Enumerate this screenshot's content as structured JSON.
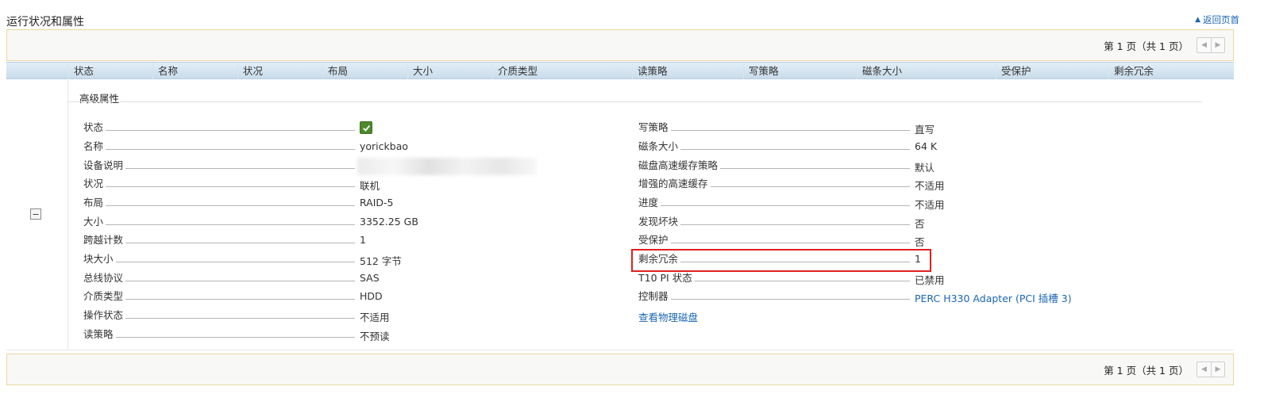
{
  "page": {
    "title": "运行状况和属性",
    "back_to_top": "返回页首"
  },
  "pager": {
    "text": "第 1 页（共 1 页）"
  },
  "table": {
    "columns": [
      "状态",
      "名称",
      "状况",
      "布局",
      "大小",
      "介质类型",
      "读策略",
      "写策略",
      "磁条大小",
      "受保护",
      "剩余冗余"
    ]
  },
  "section": {
    "title": "高级属性"
  },
  "left_props": [
    {
      "label": "状态",
      "value": ""
    },
    {
      "label": "名称",
      "value": "yorickbao"
    },
    {
      "label": "设备说明",
      "value": ""
    },
    {
      "label": "状况",
      "value": "联机"
    },
    {
      "label": "布局",
      "value": "RAID-5"
    },
    {
      "label": "大小",
      "value": "3352.25 GB"
    },
    {
      "label": "跨越计数",
      "value": "1"
    },
    {
      "label": "块大小",
      "value": "512 字节"
    },
    {
      "label": "总线协议",
      "value": "SAS"
    },
    {
      "label": "介质类型",
      "value": "HDD"
    },
    {
      "label": "操作状态",
      "value": "不适用"
    },
    {
      "label": "读策略",
      "value": "不预读"
    }
  ],
  "right_props": [
    {
      "label": "写策略",
      "value": "直写"
    },
    {
      "label": "磁条大小",
      "value": "64 K"
    },
    {
      "label": "磁盘高速缓存策略",
      "value": "默认"
    },
    {
      "label": "增强的高速缓存",
      "value": "不适用"
    },
    {
      "label": "进度",
      "value": "不适用"
    },
    {
      "label": "发现坏块",
      "value": "否"
    },
    {
      "label": "受保护",
      "value": "否"
    },
    {
      "label": "剩余冗余",
      "value": "1"
    },
    {
      "label": "T10 PI 状态",
      "value": "已禁用"
    },
    {
      "label": "控制器",
      "value": "PERC H330 Adapter (PCI 插槽 3)"
    }
  ],
  "links": {
    "view_physical_disks": "查看物理磁盘"
  },
  "colors": {
    "link": "#1a66b3",
    "highlight": "#e02020",
    "check_green": "#4f8a2e"
  },
  "icons": {
    "status_ok": "check-icon",
    "collapse": "minus-icon",
    "back_to_top": "triangle-up-icon"
  }
}
